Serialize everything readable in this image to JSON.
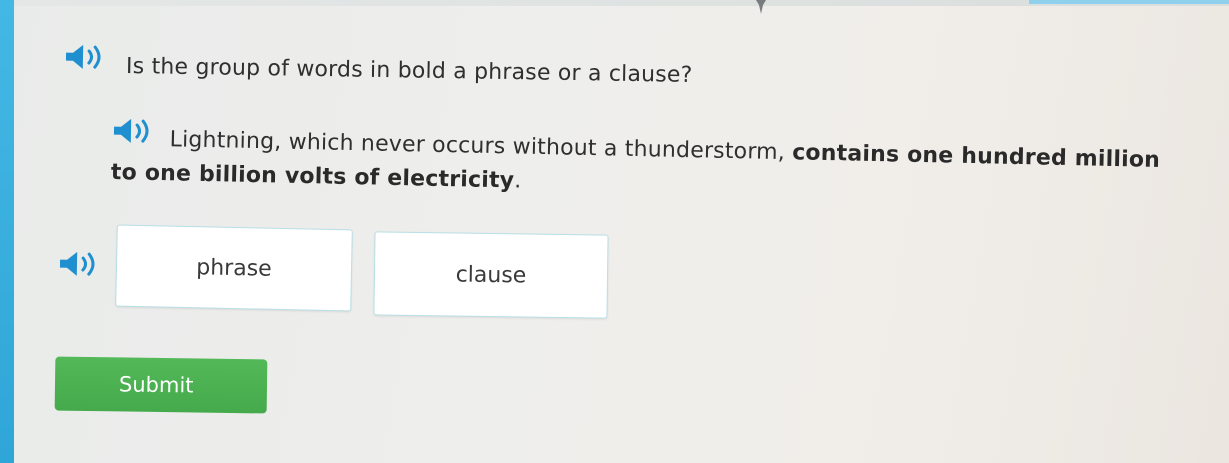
{
  "question": {
    "prompt": "Is the group of words in bold a phrase or a clause?"
  },
  "sentence": {
    "plain_text": "Lightning, which never occurs without a thunderstorm, ",
    "bold_text": "contains one hundred million to one billion volts of electricity",
    "end_punctuation": "."
  },
  "choices": [
    {
      "label": "phrase"
    },
    {
      "label": "clause"
    }
  ],
  "submit": {
    "label": "Submit"
  },
  "icons": {
    "audio": "speaker-icon"
  },
  "colors": {
    "accent_blue": "#2fa6d8",
    "submit_green": "#4cb252",
    "choice_border": "#b9dfe6",
    "icon_blue": "#1f8fd0"
  }
}
